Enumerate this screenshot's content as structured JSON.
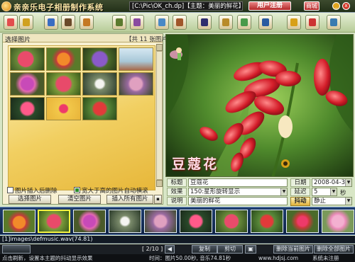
{
  "title_bar": {
    "app_title": "亲亲乐电子相册制作系统",
    "file_path": "[C:\\Pic\\OK_ch.dp]【主题：美丽的鲜花】",
    "register_label": "用户注册",
    "shop_label": "商城",
    "minimize": "_",
    "close": "x"
  },
  "left_panel": {
    "title": "选择图片",
    "count_label": "【共 11 张图片】",
    "option_delete_after_insert": "图片插入后删除",
    "option_wide_image_scroll": "宽大于高的图片自动横滚",
    "btn_select": "选择图片",
    "btn_clear": "清空图片",
    "btn_insert_all": "插入所有图片"
  },
  "preview": {
    "caption": "豆蔻花"
  },
  "properties": {
    "title_label": "标题",
    "title_value": "豆蔻花",
    "effect_label": "效果",
    "effect_value": "150:星形旋转显示",
    "desc_label": "说明",
    "desc_value": "美丽的鲜花",
    "date_label": "日期",
    "date_value": "2008-04-30",
    "delay_label": "延迟",
    "delay_value": "5",
    "delay_unit": "秒",
    "shake_label": "抖动",
    "shake_value": "静止"
  },
  "music_bar": {
    "text": "[1]images\\defmusic.wav(74.81)"
  },
  "controls": {
    "page_indicator": "[ 2/10 ]",
    "copy": "复制",
    "cut": "剪切",
    "delete_current": "删除当前图片",
    "delete_all": "删除全部图片"
  },
  "status_bar": {
    "hint": "点击刷新，设置本主题的抖动显示效果",
    "time": "时间：图片50.00秒, 音乐74.81秒",
    "url": "www.hdjsj.com",
    "reg": "系统未注册"
  },
  "colors": {
    "accent_red": "#b32525",
    "toolbar_bg": "#b7cc98",
    "filmstrip_bg": "#1e3d6e"
  }
}
